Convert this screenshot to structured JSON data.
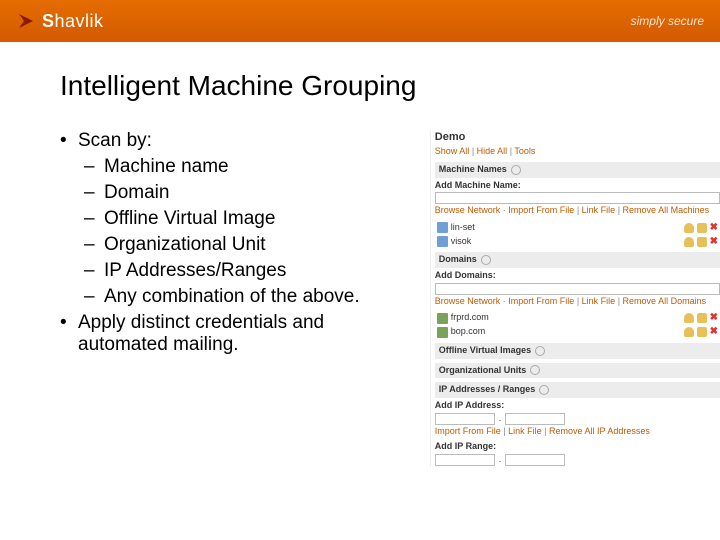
{
  "header": {
    "brand_prefix": "S",
    "brand_rest": "havlik",
    "tagline": "simply secure"
  },
  "title": "Intelligent Machine Grouping",
  "bullets": {
    "top1": "Scan by:",
    "sub": [
      "Machine name",
      "Domain",
      "Offline Virtual Image",
      "Organizational Unit",
      "IP Addresses/Ranges",
      "Any combination of the above."
    ],
    "top2": "Apply distinct credentials and automated mailing."
  },
  "panel": {
    "title": "Demo",
    "top_links": {
      "show": "Show All",
      "hide": "Hide All",
      "tools": "Tools"
    },
    "machine_names": {
      "heading": "Machine Names",
      "add_label": "Add Machine Name:",
      "links": {
        "browse": "Browse Network",
        "import": "Import From File",
        "link": "Link File",
        "remove": "Remove All Machines"
      },
      "items": [
        "lin-set",
        "visok"
      ]
    },
    "domains": {
      "heading": "Domains",
      "add_label": "Add Domains:",
      "links": {
        "browse": "Browse Network",
        "import": "Import From File",
        "link": "Link File",
        "remove": "Remove All Domains"
      },
      "items": [
        "frprd.com",
        "bop.com"
      ]
    },
    "offline": {
      "heading": "Offline Virtual Images"
    },
    "ou": {
      "heading": "Organizational Units"
    },
    "ip": {
      "heading": "IP Addresses / Ranges",
      "add_addr_label": "Add IP Address:",
      "links": {
        "import": "Import From File",
        "link": "Link File",
        "remove": "Remove All IP Addresses"
      },
      "add_range_label": "Add IP Range:"
    }
  }
}
